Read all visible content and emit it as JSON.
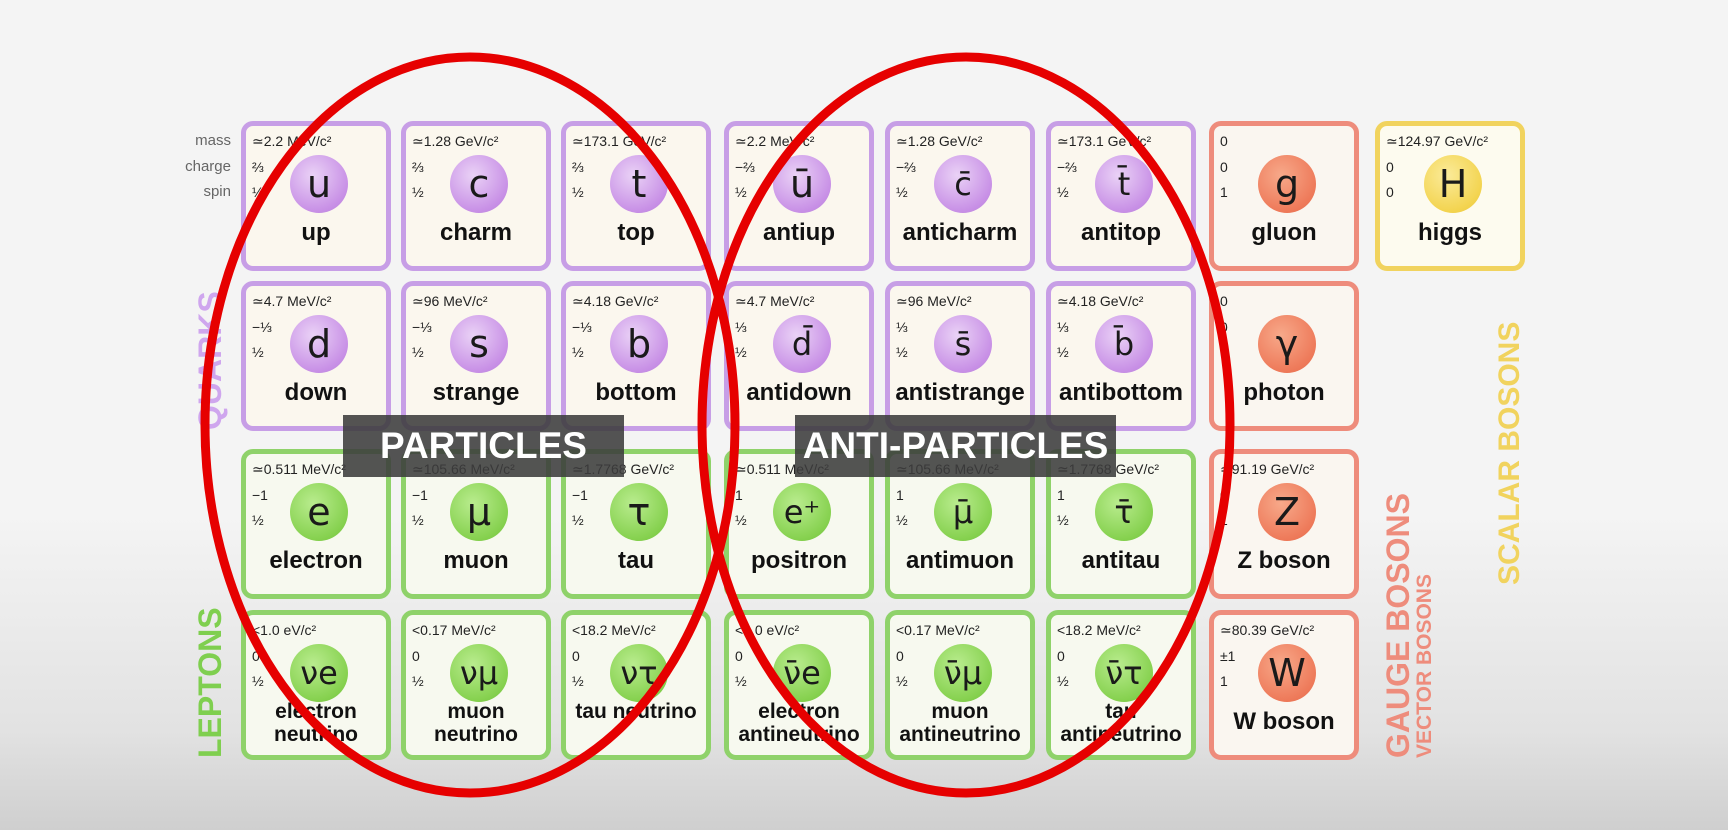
{
  "row_labels": {
    "mass": "mass",
    "charge": "charge",
    "spin": "spin"
  },
  "side_labels": {
    "quarks": "QUARKS",
    "leptons": "LEPTONS",
    "gauge_bosons": "GAUGE BOSONS",
    "vector_bosons": "VECTOR BOSONS",
    "scalar_bosons": "SCALAR BOSONS"
  },
  "banners": {
    "particles": "PARTICLES",
    "anti_particles": "ANTI-PARTICLES"
  },
  "colors": {
    "quark": "#c79ee6",
    "lepton": "#8fd26a",
    "gauge": "#ee8c7c",
    "scalar": "#f1d35e",
    "oval": "#e60000"
  },
  "particles": [
    {
      "mass": "≃2.2 MeV/c²",
      "charge": "⅔",
      "spin": "½",
      "symbol": "u",
      "name": "up"
    },
    {
      "mass": "≃1.28 GeV/c²",
      "charge": "⅔",
      "spin": "½",
      "symbol": "c",
      "name": "charm"
    },
    {
      "mass": "≃173.1 GeV/c²",
      "charge": "⅔",
      "spin": "½",
      "symbol": "t",
      "name": "top"
    },
    {
      "mass": "≃2.2 MeV/c²",
      "charge": "−⅔",
      "spin": "½",
      "symbol": "ū",
      "name": "antiup"
    },
    {
      "mass": "≃1.28 GeV/c²",
      "charge": "−⅔",
      "spin": "½",
      "symbol": "c̄",
      "name": "anticharm"
    },
    {
      "mass": "≃173.1 GeV/c²",
      "charge": "−⅔",
      "spin": "½",
      "symbol": "t̄",
      "name": "antitop"
    },
    {
      "mass": "0",
      "charge": "0",
      "spin": "1",
      "symbol": "g",
      "name": "gluon"
    },
    {
      "mass": "≃124.97 GeV/c²",
      "charge": "0",
      "spin": "0",
      "symbol": "H",
      "name": "higgs"
    },
    {
      "mass": "≃4.7 MeV/c²",
      "charge": "−⅓",
      "spin": "½",
      "symbol": "d",
      "name": "down"
    },
    {
      "mass": "≃96 MeV/c²",
      "charge": "−⅓",
      "spin": "½",
      "symbol": "s",
      "name": "strange"
    },
    {
      "mass": "≃4.18 GeV/c²",
      "charge": "−⅓",
      "spin": "½",
      "symbol": "b",
      "name": "bottom"
    },
    {
      "mass": "≃4.7 MeV/c²",
      "charge": "⅓",
      "spin": "½",
      "symbol": "d̄",
      "name": "antidown"
    },
    {
      "mass": "≃96 MeV/c²",
      "charge": "⅓",
      "spin": "½",
      "symbol": "s̄",
      "name": "antistrange"
    },
    {
      "mass": "≃4.18 GeV/c²",
      "charge": "⅓",
      "spin": "½",
      "symbol": "b̄",
      "name": "antibottom"
    },
    {
      "mass": "0",
      "charge": "0",
      "spin": "1",
      "symbol": "γ",
      "name": "photon"
    },
    {
      "mass": "≃0.511 MeV/c²",
      "charge": "−1",
      "spin": "½",
      "symbol": "e",
      "name": "electron"
    },
    {
      "mass": "≃105.66 MeV/c²",
      "charge": "−1",
      "spin": "½",
      "symbol": "μ",
      "name": "muon"
    },
    {
      "mass": "≃1.7768 GeV/c²",
      "charge": "−1",
      "spin": "½",
      "symbol": "τ",
      "name": "tau"
    },
    {
      "mass": "≃0.511 MeV/c²",
      "charge": "1",
      "spin": "½",
      "symbol": "e⁺",
      "name": "positron"
    },
    {
      "mass": "≃105.66 MeV/c²",
      "charge": "1",
      "spin": "½",
      "symbol": "μ̄",
      "name": "antimuon"
    },
    {
      "mass": "≃1.7768 GeV/c²",
      "charge": "1",
      "spin": "½",
      "symbol": "τ̄",
      "name": "antitau"
    },
    {
      "mass": "≃91.19 GeV/c²",
      "charge": "0",
      "spin": "1",
      "symbol": "Z",
      "name": "Z boson"
    },
    {
      "mass": "<1.0 eV/c²",
      "charge": "0",
      "spin": "½",
      "symbol": "νe",
      "name": "electron neutrino"
    },
    {
      "mass": "<0.17 MeV/c²",
      "charge": "0",
      "spin": "½",
      "symbol": "νμ",
      "name": "muon neutrino"
    },
    {
      "mass": "<18.2 MeV/c²",
      "charge": "0",
      "spin": "½",
      "symbol": "ντ",
      "name": "tau neutrino"
    },
    {
      "mass": "<1.0 eV/c²",
      "charge": "0",
      "spin": "½",
      "symbol": "ν̄e",
      "name": "electron antineutrino"
    },
    {
      "mass": "<0.17 MeV/c²",
      "charge": "0",
      "spin": "½",
      "symbol": "ν̄μ",
      "name": "muon antineutrino"
    },
    {
      "mass": "<18.2 MeV/c²",
      "charge": "0",
      "spin": "½",
      "symbol": "ν̄τ",
      "name": "tau antineutrino"
    },
    {
      "mass": "≃80.39 GeV/c²",
      "charge": "±1",
      "spin": "1",
      "symbol": "W",
      "name": "W boson"
    }
  ]
}
